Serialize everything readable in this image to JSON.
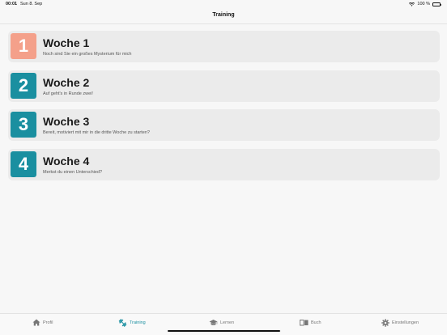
{
  "status_bar": {
    "time": "00:01",
    "date": "Sun 8. Sep",
    "battery": "100 %"
  },
  "nav": {
    "title": "Training"
  },
  "weeks": [
    {
      "number": "1",
      "title": "Woche 1",
      "subtitle": "Noch sind Sie ein großes Mysterium für mich",
      "color": "#f4a08a"
    },
    {
      "number": "2",
      "title": "Woche 2",
      "subtitle": "Auf geht's in Runde zwei!",
      "color": "#1a8fa0"
    },
    {
      "number": "3",
      "title": "Woche 3",
      "subtitle": "Bereit, motiviert mit mir in die dritte Woche zu starten?",
      "color": "#1a8fa0"
    },
    {
      "number": "4",
      "title": "Woche 4",
      "subtitle": "Merkst du einen Unterschied?",
      "color": "#1a8fa0"
    }
  ],
  "tabs": {
    "profil": {
      "label": "Profil",
      "icon": "home-icon"
    },
    "training": {
      "label": "Training",
      "icon": "dumbbell-icon"
    },
    "lernen": {
      "label": "Lernen",
      "icon": "graduation-cap-icon"
    },
    "buch": {
      "label": "Buch",
      "icon": "book-icon"
    },
    "einstellungen": {
      "label": "Einstellungen",
      "icon": "gear-icon"
    }
  },
  "colors": {
    "accent": "#1a8fa0",
    "week1": "#f4a08a",
    "inactive": "#777777"
  }
}
